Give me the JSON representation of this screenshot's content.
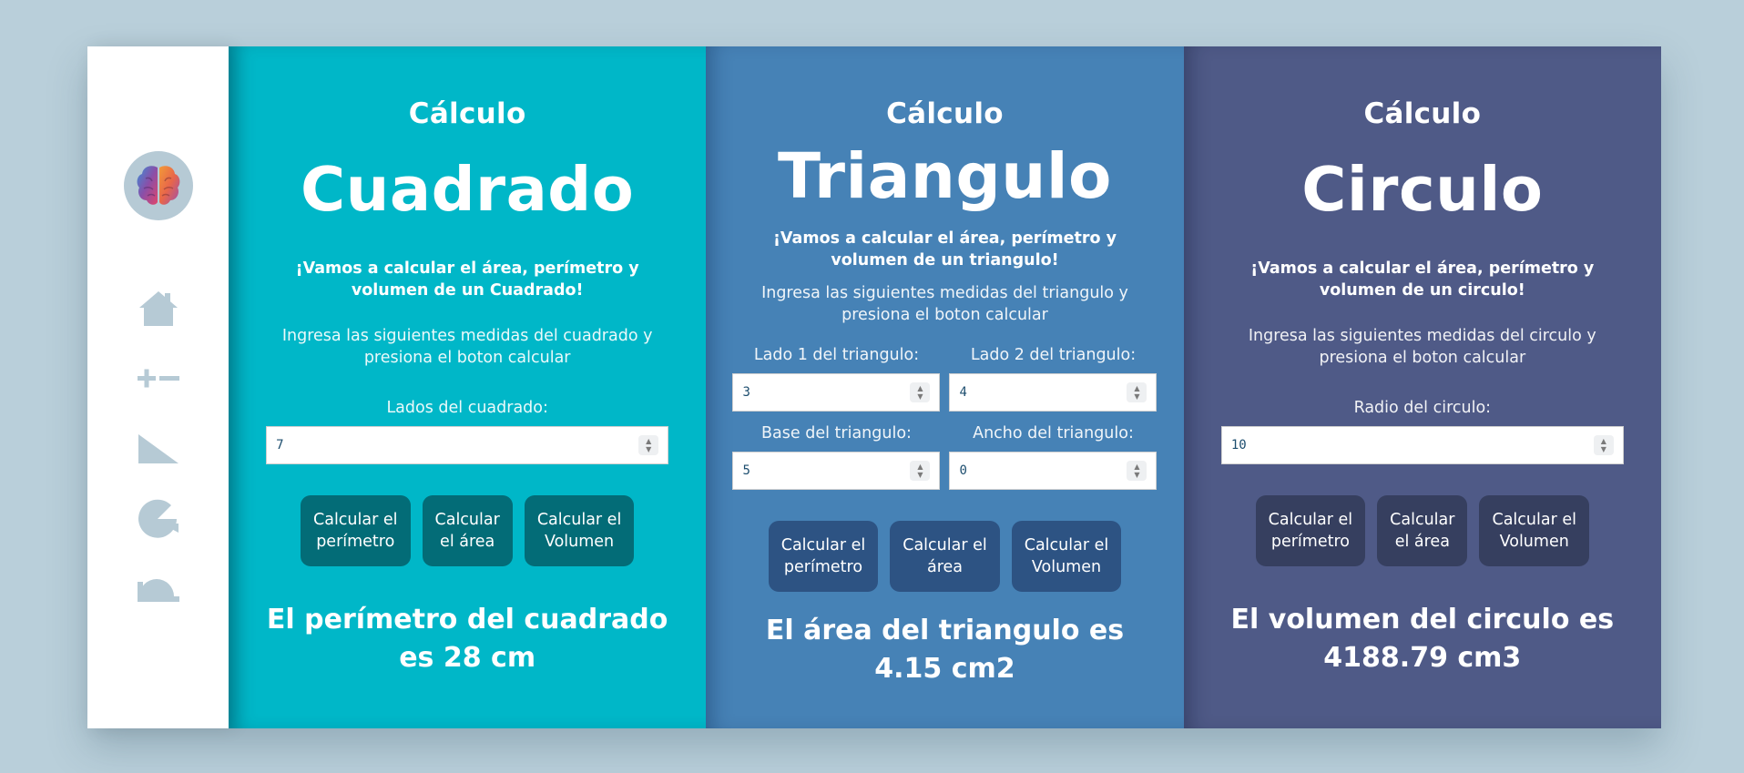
{
  "colors": {
    "background": "#b9cfda",
    "sidebar": "#ffffff",
    "icon": "#b6cad5",
    "square_panel": "#00b7c8",
    "square_button": "#036c77",
    "triangle_panel": "#4682b6",
    "triangle_button": "#2d5383",
    "circle_panel": "#4f5a87",
    "circle_button": "#363f5f"
  },
  "sidebar": {
    "logo_icon": "brain-icon",
    "items": [
      {
        "icon": "home-icon"
      },
      {
        "icon": "plus-minus-icon"
      },
      {
        "icon": "triangle-icon"
      },
      {
        "icon": "circle-icon"
      },
      {
        "icon": "semicircle-icon"
      }
    ]
  },
  "square": {
    "kicker": "Cálculo",
    "title": "Cuadrado",
    "intro": "¡Vamos a calcular el área, perímetro y volumen de un Cuadrado!",
    "instructions": "Ingresa las siguientes medidas del cuadrado y presiona el boton calcular",
    "side_label": "Lados del cuadrado:",
    "side_value": "7",
    "buttons": {
      "perimeter": "Calcular el\nperímetro",
      "area": "Calcular\nel área",
      "volume": "Calcular el\nVolumen"
    },
    "result": "El perímetro del cuadrado es 28 cm"
  },
  "triangle": {
    "kicker": "Cálculo",
    "title": "Triangulo",
    "intro": "¡Vamos a calcular el área, perímetro y volumen de un triangulo!",
    "instructions": "Ingresa las siguientes medidas del triangulo y presiona el boton calcular",
    "side1_label": "Lado 1 del triangulo:",
    "side1_value": "3",
    "side2_label": "Lado 2 del triangulo:",
    "side2_value": "4",
    "base_label": "Base del triangulo:",
    "base_value": "5",
    "width_label": "Ancho del triangulo:",
    "width_value": "0",
    "buttons": {
      "perimeter": "Calcular el\nperímetro",
      "area": "Calcular el\nárea",
      "volume": "Calcular el\nVolumen"
    },
    "result": "El área del triangulo es 4.15 cm2"
  },
  "circle": {
    "kicker": "Cálculo",
    "title": "Circulo",
    "intro": "¡Vamos a calcular el área, perímetro y volumen de un circulo!",
    "instructions": "Ingresa las siguientes medidas del circulo y presiona el boton calcular",
    "radius_label": "Radio del circulo:",
    "radius_value": "10",
    "buttons": {
      "perimeter": "Calcular el\nperímetro",
      "area": "Calcular\nel área",
      "volume": "Calcular el\nVolumen"
    },
    "result": "El volumen del circulo es 4188.79 cm3"
  }
}
